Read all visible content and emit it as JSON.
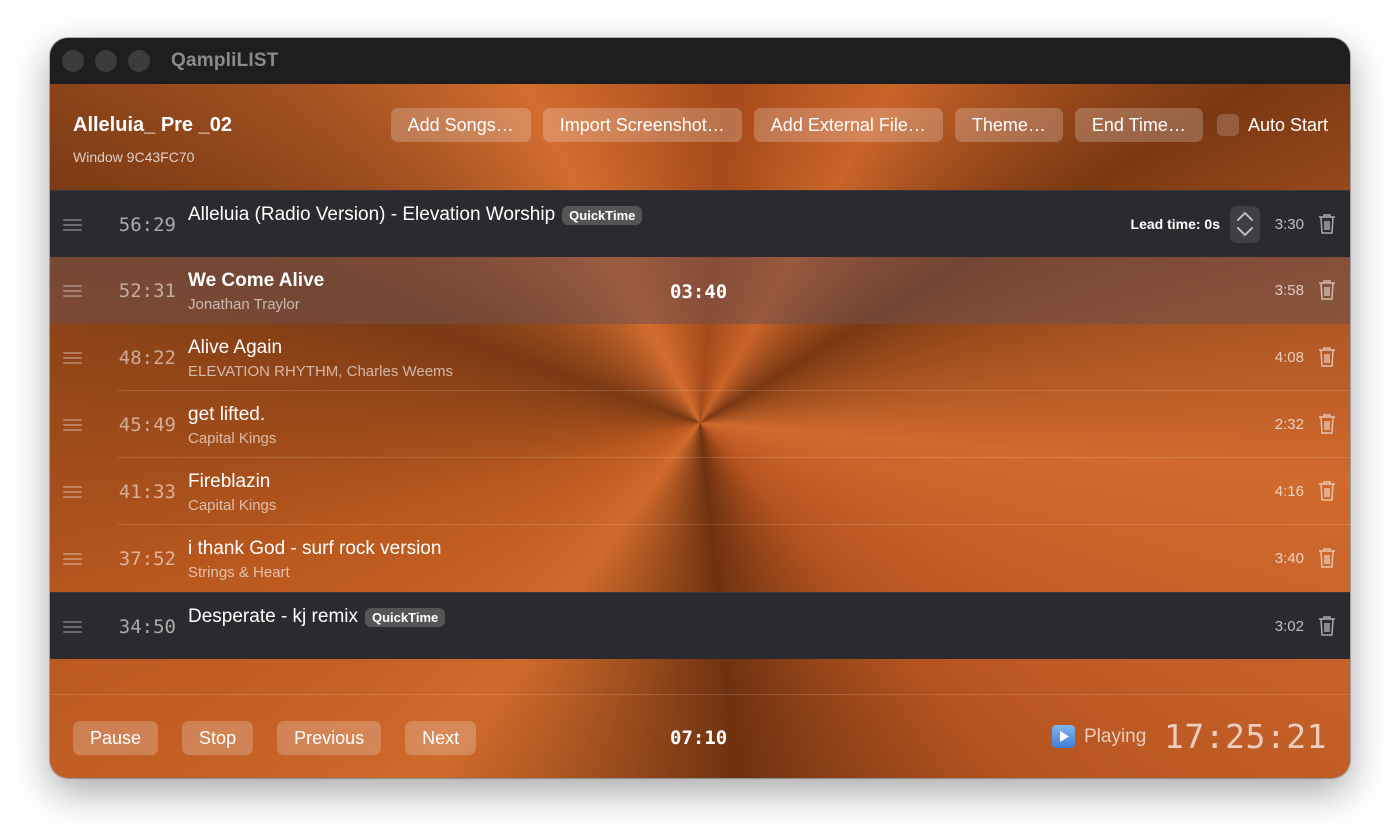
{
  "app": {
    "title": "QampliLIST"
  },
  "header": {
    "playlist_name": "Alleluia_ Pre _02",
    "window_id": "Window 9C43FC70",
    "buttons": {
      "add_songs": "Add Songs…",
      "import_screenshot": "Import Screenshot…",
      "add_external_file": "Add External File…",
      "theme": "Theme…",
      "end_time": "End Time…"
    },
    "auto_start_label": "Auto Start"
  },
  "rows": [
    {
      "start": "56:29",
      "title": "Alleluia (Radio Version) - Elevation Worship",
      "badge": "QuickTime",
      "artist": "",
      "lead_time": "Lead time: 0s",
      "duration": "3:30"
    },
    {
      "start": "52:31",
      "title": "We Come Alive",
      "artist": "Jonathan Traylor",
      "countdown": "03:40",
      "duration": "3:58"
    },
    {
      "start": "48:22",
      "title": "Alive Again",
      "artist": "ELEVATION RHYTHM, Charles Weems",
      "duration": "4:08"
    },
    {
      "start": "45:49",
      "title": "get lifted.",
      "artist": "Capital Kings",
      "duration": "2:32"
    },
    {
      "start": "41:33",
      "title": "Fireblazin",
      "artist": "Capital Kings",
      "duration": "4:16"
    },
    {
      "start": "37:52",
      "title": "i thank God - surf rock version",
      "artist": "Strings & Heart",
      "duration": "3:40"
    },
    {
      "start": "34:50",
      "title": "Desperate - kj remix",
      "badge": "QuickTime",
      "artist": "",
      "duration": "3:02"
    }
  ],
  "footer": {
    "pause": "Pause",
    "stop": "Stop",
    "previous": "Previous",
    "next": "Next",
    "total_time": "07:10",
    "status": "Playing",
    "clock": "17:25:21"
  },
  "colors": {
    "titlebar": "#1e1e20",
    "external_row": "#2b2b2f",
    "theme_orange": "#c9642a",
    "play_icon": "#4a8ad8"
  }
}
